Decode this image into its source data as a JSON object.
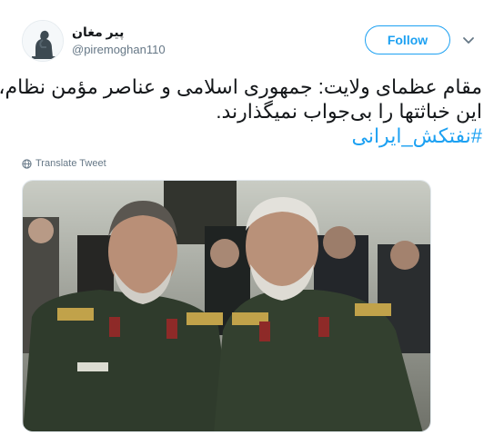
{
  "tweet": {
    "display_name": "پیر مغان",
    "handle": "@piremoghan110",
    "follow_label": "Follow",
    "text_line1": "مقام عظمای ولایت: جمهوری اسلامی و عناصر مؤمن نظام،",
    "text_line2": "این خباثتها را بی‌جواب نمیگذارند.",
    "hashtag": "#نفتکش_ایرانی",
    "translate_label": "Translate Tweet"
  },
  "icons": {
    "avatar": "thinker-statue-avatar",
    "menu": "chevron-down-icon",
    "translate": "globe-icon"
  },
  "colors": {
    "accent": "#1da1f2",
    "text": "#14171a",
    "secondary": "#657786",
    "uniform": "#2f3b2c"
  }
}
